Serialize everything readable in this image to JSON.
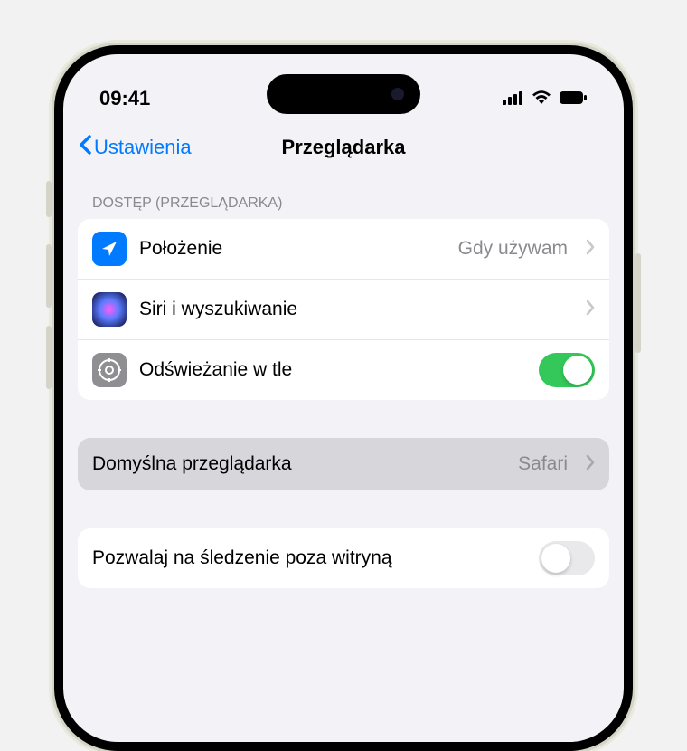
{
  "status_bar": {
    "time": "09:41"
  },
  "nav": {
    "back_label": "Ustawienia",
    "title": "Przeglądarka"
  },
  "sections": {
    "access": {
      "header": "DOSTĘP (PRZEGLĄDARKA)",
      "rows": {
        "location": {
          "label": "Położenie",
          "value": "Gdy używam"
        },
        "siri": {
          "label": "Siri i wyszukiwanie"
        },
        "background_refresh": {
          "label": "Odświeżanie w tle",
          "toggle": true
        }
      }
    },
    "default_browser": {
      "label": "Domyślna przeglądarka",
      "value": "Safari"
    },
    "cross_site_tracking": {
      "label": "Pozwalaj na śledzenie poza witryną",
      "toggle": false
    }
  },
  "colors": {
    "accent": "#007aff",
    "toggle_on": "#34c759",
    "secondary_text": "#8a8a8e"
  }
}
